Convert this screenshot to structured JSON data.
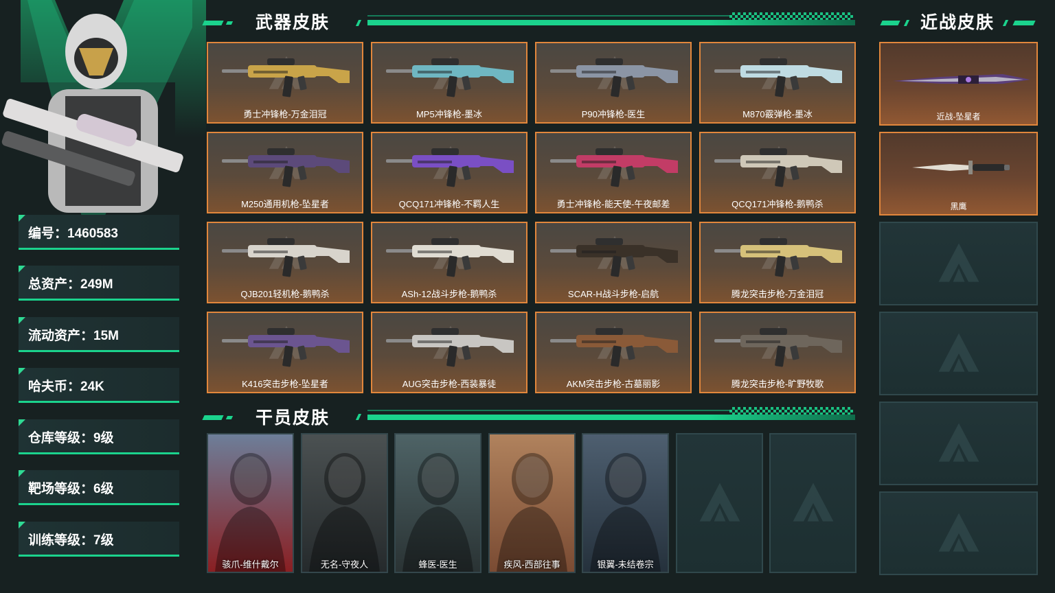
{
  "profile": {
    "stats": [
      {
        "label": "编号：",
        "value": "1460583"
      },
      {
        "label": "总资产：",
        "value": "249M"
      },
      {
        "label": "流动资产：",
        "value": "15M"
      },
      {
        "label": "哈夫币：",
        "value": "24K"
      },
      {
        "label": "仓库等级：",
        "value": "9级"
      },
      {
        "label": "靶场等级：",
        "value": "6级"
      },
      {
        "label": "训练等级：",
        "value": "7级"
      }
    ]
  },
  "sections": {
    "weapons_title": "武器皮肤",
    "melee_title": "近战皮肤",
    "operators_title": "干员皮肤"
  },
  "weapons": [
    {
      "name": "勇士冲锋枪-万金泪冠",
      "color": "#c9a449"
    },
    {
      "name": "MP5冲锋枪-墨冰",
      "color": "#6fb7c2"
    },
    {
      "name": "P90冲锋枪-医生",
      "color": "#8b95a5"
    },
    {
      "name": "M870霰弹枪-墨冰",
      "color": "#bfdbe2"
    },
    {
      "name": "M250通用机枪-坠星者",
      "color": "#5c4a7a"
    },
    {
      "name": "QCQ171冲锋枪-不羁人生",
      "color": "#7a4fc4"
    },
    {
      "name": "勇士冲锋枪-能天使-午夜邮差",
      "color": "#c23c66"
    },
    {
      "name": "QCQ171冲锋枪-鹅鸭杀",
      "color": "#cfc8b8"
    },
    {
      "name": "QJB201轻机枪-鹅鸭杀",
      "color": "#d8d4cc"
    },
    {
      "name": "ASh-12战斗步枪-鹅鸭杀",
      "color": "#e0dcd2"
    },
    {
      "name": "SCAR-H战斗步枪-启航",
      "color": "#3a3128"
    },
    {
      "name": "腾龙突击步枪-万金泪冠",
      "color": "#d6c17a"
    },
    {
      "name": "K416突击步枪-坠星者",
      "color": "#6b5590"
    },
    {
      "name": "AUG突击步枪-西装暴徒",
      "color": "#c8c6c2"
    },
    {
      "name": "AKM突击步枪-古墓丽影",
      "color": "#8a5a38"
    },
    {
      "name": "腾龙突击步枪-旷野牧歌",
      "color": "#6e665c"
    }
  ],
  "melee": [
    {
      "name": "近战-坠星者",
      "icon": "dagger-icon"
    },
    {
      "name": "黑鹰",
      "icon": "knife-icon"
    }
  ],
  "operators": [
    {
      "name": "骇爪-维什戴尔",
      "color_top": "#6d7e99",
      "color_bottom": "#8a1f22"
    },
    {
      "name": "无名-守夜人",
      "color_top": "#4b5152",
      "color_bottom": "#252a2c"
    },
    {
      "name": "蜂医-医生",
      "color_top": "#4e6366",
      "color_bottom": "#2a3334"
    },
    {
      "name": "疾风-西部往事",
      "color_top": "#b0825d",
      "color_bottom": "#7a4b33"
    },
    {
      "name": "银翼-未结卷宗",
      "color_top": "#4e5f70",
      "color_bottom": "#25313c"
    }
  ],
  "colors": {
    "accent": "#1bd38d",
    "card_border": "#e2873c",
    "background": "#172121"
  }
}
